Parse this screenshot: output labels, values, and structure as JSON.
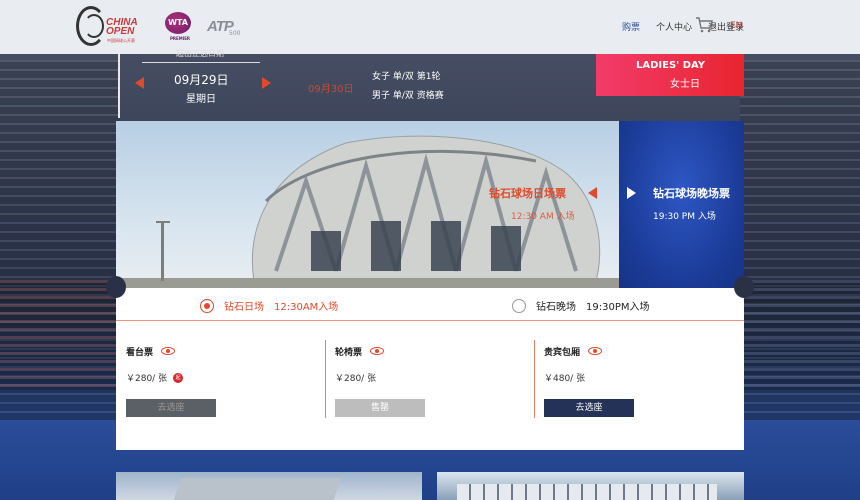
{
  "header": {
    "logos": {
      "china_open": "CHINA OPEN",
      "china_open_sub": "中国网球公开赛",
      "wta": "WTA",
      "wta_sub": "PREMIER",
      "atp": "ATP",
      "atp_sub": "500"
    },
    "nav": [
      "购票",
      "个人中心",
      "退出登录"
    ],
    "lang": "EN",
    "accent": "#2f4fa0"
  },
  "schedule": {
    "cut_label": "超出正选日期",
    "date": "09月29日",
    "weekday": "星期日",
    "next_day": "09月30日",
    "events": [
      "女子 单/双 第1轮",
      "男子 单/双 资格赛"
    ],
    "ladies_day": {
      "en": "LADIES' DAY",
      "cn": "女士日"
    }
  },
  "stadium": {
    "day_label": "钻石球场日场票",
    "day_time": "12:30 AM 入场",
    "night_label": "钻石球场晚场票",
    "night_time": "19:30 PM 入场"
  },
  "sessions": [
    {
      "name": "钻石日场",
      "time": "12:30AM入场",
      "selected": true
    },
    {
      "name": "钻石晚场",
      "time": "19:30PM入场",
      "selected": false
    }
  ],
  "tickets": [
    {
      "name": "看台票",
      "price": "￥280/ 张",
      "badge": "起",
      "button": "去选座",
      "state": "disabled"
    },
    {
      "name": "轮椅票",
      "price": "￥280/ 张",
      "button": "售罄",
      "state": "soldout"
    },
    {
      "name": "贵宾包厢",
      "price": "￥480/ 张",
      "button": "去选座",
      "state": "active"
    }
  ],
  "colors": {
    "brand_red": "#e04a2a",
    "navy": "#253257",
    "ladies_pink": "#f23b6a"
  }
}
